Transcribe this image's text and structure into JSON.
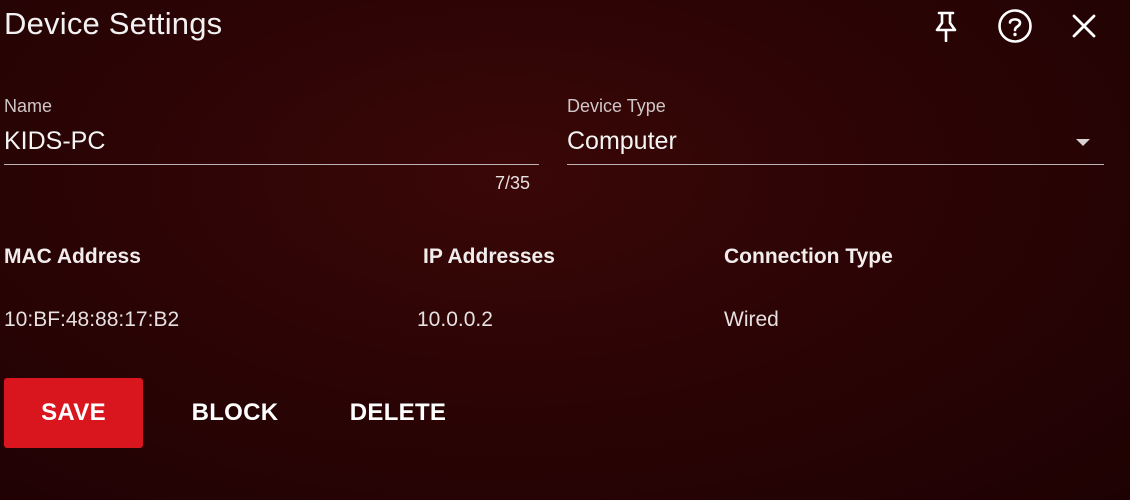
{
  "dialog": {
    "title": "Device Settings"
  },
  "header_icons": {
    "pin": "pin-icon",
    "help": "help-icon",
    "close": "close-icon"
  },
  "fields": {
    "name": {
      "label": "Name",
      "value": "KIDS-PC",
      "counter": "7/35"
    },
    "device_type": {
      "label": "Device Type",
      "value": "Computer"
    }
  },
  "info": {
    "mac": {
      "label": "MAC Address",
      "value": "10:BF:48:88:17:B2"
    },
    "ip": {
      "label": "IP Addresses",
      "value": "10.0.0.2"
    },
    "connection": {
      "label": "Connection Type",
      "value": "Wired"
    }
  },
  "actions": {
    "save": "SAVE",
    "block": "BLOCK",
    "delete": "DELETE"
  },
  "colors": {
    "accent": "#d9161d",
    "background": "#2c0405"
  }
}
